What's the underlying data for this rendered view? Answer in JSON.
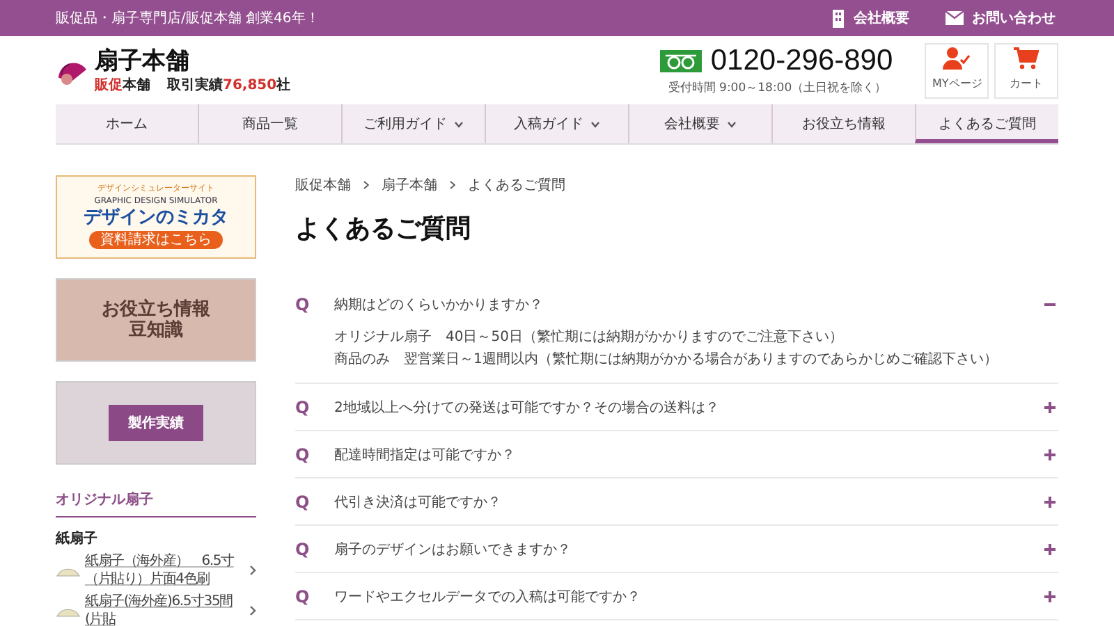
{
  "top_bar": {
    "tagline": "販促品・扇子専門店/販促本舗 創業46年！",
    "links": [
      {
        "label": "会社概要"
      },
      {
        "label": "お問い合わせ"
      }
    ]
  },
  "header": {
    "logo": {
      "name": "扇子本舗",
      "brand_red": "販促",
      "brand_rest": "本舗",
      "stats_label": "取引実績",
      "stats_count": "76,850",
      "stats_unit": "社"
    },
    "phone": {
      "number": "0120-296-890",
      "hours": "受付時間 9:00～18:00（土日祝を除く）"
    },
    "buttons": [
      {
        "label": "MYページ"
      },
      {
        "label": "カート"
      }
    ]
  },
  "nav": [
    {
      "label": "ホーム",
      "dropdown": false,
      "selected": false
    },
    {
      "label": "商品一覧",
      "dropdown": false,
      "selected": false
    },
    {
      "label": "ご利用ガイド",
      "dropdown": true,
      "selected": false
    },
    {
      "label": "入稿ガイド",
      "dropdown": true,
      "selected": false
    },
    {
      "label": "会社概要",
      "dropdown": true,
      "selected": false
    },
    {
      "label": "お役立ち情報",
      "dropdown": false,
      "selected": false
    },
    {
      "label": "よくあるご質問",
      "dropdown": false,
      "selected": true
    }
  ],
  "sidebar": {
    "banners": [
      {
        "kind": "simulator",
        "kicker": "デザインシミュレーターサイト",
        "subtitle": "GRAPHIC DESIGN SIMULATOR",
        "title": "デザインのミカタ",
        "button": "資料請求はこちら"
      },
      {
        "kind": "photo",
        "title_lines": [
          "お役立ち情報",
          "豆知識"
        ]
      },
      {
        "kind": "fans",
        "title": "製作実績"
      }
    ],
    "section": "オリジナル扇子",
    "category": "紙扇子",
    "products": [
      {
        "name": "紙扇子（海外産）　6.5寸（片貼り）片面4色刷"
      },
      {
        "name": "紙扇子(海外産)6.5寸35間(片貼"
      }
    ]
  },
  "breadcrumb": [
    "販促本舗",
    "扇子本舗",
    "よくあるご質問"
  ],
  "title": "よくあるご質問",
  "faq": [
    {
      "mark": "Q",
      "question": "納期はどのくらいかかりますか？",
      "expanded": true,
      "answer": [
        "オリジナル扇子　40日～50日（繁忙期には納期がかかりますのでご注意下さい）",
        "商品のみ　翌営業日～1週間以内（繁忙期には納期がかかる場合がありますのであらかじめご確認下さい）"
      ]
    },
    {
      "mark": "Q",
      "question": "2地域以上へ分けての発送は可能ですか？その場合の送料は？",
      "expanded": false
    },
    {
      "mark": "Q",
      "question": "配達時間指定は可能ですか？",
      "expanded": false
    },
    {
      "mark": "Q",
      "question": "代引き決済は可能ですか？",
      "expanded": false
    },
    {
      "mark": "Q",
      "question": "扇子のデザインはお願いできますか？",
      "expanded": false
    },
    {
      "mark": "Q",
      "question": "ワードやエクセルデータでの入稿は可能ですか？",
      "expanded": false
    }
  ]
}
